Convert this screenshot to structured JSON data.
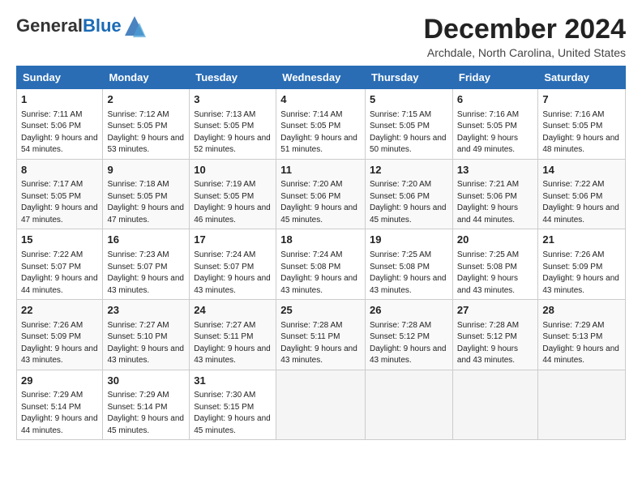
{
  "header": {
    "logo_general": "General",
    "logo_blue": "Blue",
    "month_title": "December 2024",
    "location": "Archdale, North Carolina, United States"
  },
  "days_of_week": [
    "Sunday",
    "Monday",
    "Tuesday",
    "Wednesday",
    "Thursday",
    "Friday",
    "Saturday"
  ],
  "weeks": [
    [
      {
        "day": "1",
        "sunrise": "7:11 AM",
        "sunset": "5:06 PM",
        "daylight": "9 hours and 54 minutes."
      },
      {
        "day": "2",
        "sunrise": "7:12 AM",
        "sunset": "5:05 PM",
        "daylight": "9 hours and 53 minutes."
      },
      {
        "day": "3",
        "sunrise": "7:13 AM",
        "sunset": "5:05 PM",
        "daylight": "9 hours and 52 minutes."
      },
      {
        "day": "4",
        "sunrise": "7:14 AM",
        "sunset": "5:05 PM",
        "daylight": "9 hours and 51 minutes."
      },
      {
        "day": "5",
        "sunrise": "7:15 AM",
        "sunset": "5:05 PM",
        "daylight": "9 hours and 50 minutes."
      },
      {
        "day": "6",
        "sunrise": "7:16 AM",
        "sunset": "5:05 PM",
        "daylight": "9 hours and 49 minutes."
      },
      {
        "day": "7",
        "sunrise": "7:16 AM",
        "sunset": "5:05 PM",
        "daylight": "9 hours and 48 minutes."
      }
    ],
    [
      {
        "day": "8",
        "sunrise": "7:17 AM",
        "sunset": "5:05 PM",
        "daylight": "9 hours and 47 minutes."
      },
      {
        "day": "9",
        "sunrise": "7:18 AM",
        "sunset": "5:05 PM",
        "daylight": "9 hours and 47 minutes."
      },
      {
        "day": "10",
        "sunrise": "7:19 AM",
        "sunset": "5:05 PM",
        "daylight": "9 hours and 46 minutes."
      },
      {
        "day": "11",
        "sunrise": "7:20 AM",
        "sunset": "5:06 PM",
        "daylight": "9 hours and 45 minutes."
      },
      {
        "day": "12",
        "sunrise": "7:20 AM",
        "sunset": "5:06 PM",
        "daylight": "9 hours and 45 minutes."
      },
      {
        "day": "13",
        "sunrise": "7:21 AM",
        "sunset": "5:06 PM",
        "daylight": "9 hours and 44 minutes."
      },
      {
        "day": "14",
        "sunrise": "7:22 AM",
        "sunset": "5:06 PM",
        "daylight": "9 hours and 44 minutes."
      }
    ],
    [
      {
        "day": "15",
        "sunrise": "7:22 AM",
        "sunset": "5:07 PM",
        "daylight": "9 hours and 44 minutes."
      },
      {
        "day": "16",
        "sunrise": "7:23 AM",
        "sunset": "5:07 PM",
        "daylight": "9 hours and 43 minutes."
      },
      {
        "day": "17",
        "sunrise": "7:24 AM",
        "sunset": "5:07 PM",
        "daylight": "9 hours and 43 minutes."
      },
      {
        "day": "18",
        "sunrise": "7:24 AM",
        "sunset": "5:08 PM",
        "daylight": "9 hours and 43 minutes."
      },
      {
        "day": "19",
        "sunrise": "7:25 AM",
        "sunset": "5:08 PM",
        "daylight": "9 hours and 43 minutes."
      },
      {
        "day": "20",
        "sunrise": "7:25 AM",
        "sunset": "5:08 PM",
        "daylight": "9 hours and 43 minutes."
      },
      {
        "day": "21",
        "sunrise": "7:26 AM",
        "sunset": "5:09 PM",
        "daylight": "9 hours and 43 minutes."
      }
    ],
    [
      {
        "day": "22",
        "sunrise": "7:26 AM",
        "sunset": "5:09 PM",
        "daylight": "9 hours and 43 minutes."
      },
      {
        "day": "23",
        "sunrise": "7:27 AM",
        "sunset": "5:10 PM",
        "daylight": "9 hours and 43 minutes."
      },
      {
        "day": "24",
        "sunrise": "7:27 AM",
        "sunset": "5:11 PM",
        "daylight": "9 hours and 43 minutes."
      },
      {
        "day": "25",
        "sunrise": "7:28 AM",
        "sunset": "5:11 PM",
        "daylight": "9 hours and 43 minutes."
      },
      {
        "day": "26",
        "sunrise": "7:28 AM",
        "sunset": "5:12 PM",
        "daylight": "9 hours and 43 minutes."
      },
      {
        "day": "27",
        "sunrise": "7:28 AM",
        "sunset": "5:12 PM",
        "daylight": "9 hours and 43 minutes."
      },
      {
        "day": "28",
        "sunrise": "7:29 AM",
        "sunset": "5:13 PM",
        "daylight": "9 hours and 44 minutes."
      }
    ],
    [
      {
        "day": "29",
        "sunrise": "7:29 AM",
        "sunset": "5:14 PM",
        "daylight": "9 hours and 44 minutes."
      },
      {
        "day": "30",
        "sunrise": "7:29 AM",
        "sunset": "5:14 PM",
        "daylight": "9 hours and 45 minutes."
      },
      {
        "day": "31",
        "sunrise": "7:30 AM",
        "sunset": "5:15 PM",
        "daylight": "9 hours and 45 minutes."
      },
      null,
      null,
      null,
      null
    ]
  ]
}
